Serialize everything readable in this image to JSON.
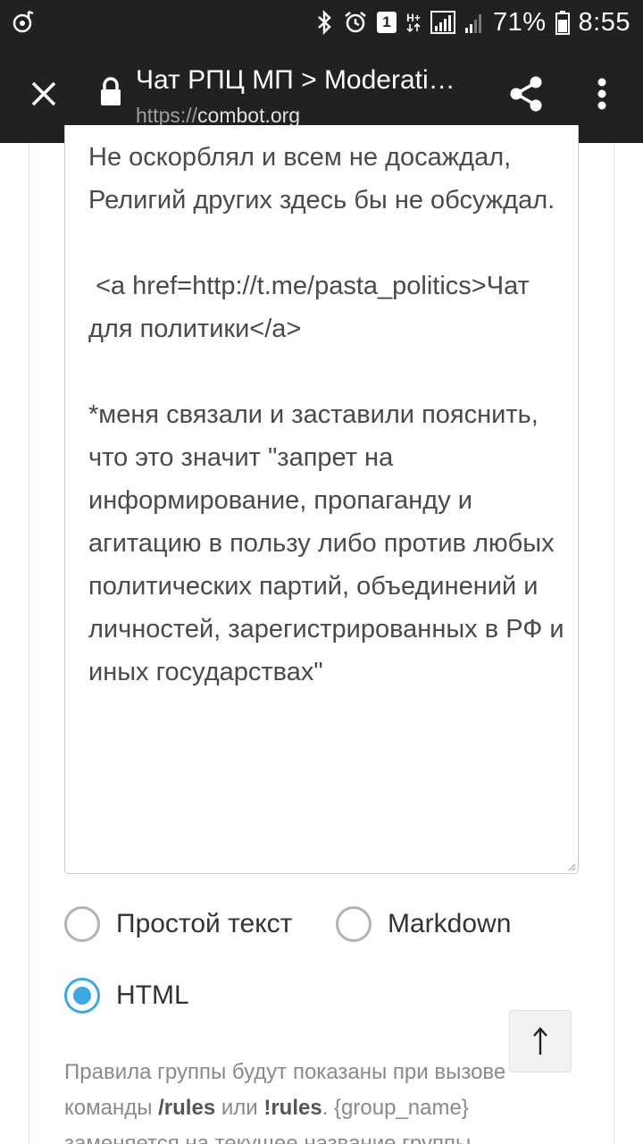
{
  "status_bar": {
    "notification_badge": "1",
    "network": "H+",
    "battery": "71%",
    "time": "8:55"
  },
  "app_bar": {
    "title": "Чат РПЦ МП > Moderati…",
    "url_scheme": "https://",
    "url_host": "combot.org",
    "icons": [
      "close-icon",
      "lock-icon",
      "share-icon",
      "more-vert-icon"
    ]
  },
  "editor": {
    "rules_text": "Не оскорблял и всем не досаждал,\nРелигий других здесь бы не обсуждал.\n\n <a href=http://t.me/pasta_politics>Чат для политики</a>\n\n*меня связали и заставили пояснить, что это значит \"запрет на информирование, пропаганду и агитацию в пользу либо против любых политических партий, объединений и личностей, зарегистрированных в РФ и иных государствах\""
  },
  "format_options": {
    "plain": "Простой текст",
    "markdown": "Markdown",
    "html": "HTML",
    "selected": "HTML"
  },
  "help": {
    "p1": "Правила группы будут показаны при вызове команды ",
    "cmd1": "/rules",
    "or": " или ",
    "cmd2": "!rules",
    "p2": ". {group_name} заменяется на текущее название группы."
  },
  "colors": {
    "toolbar": "#212121",
    "accent": "#3da9e0"
  }
}
